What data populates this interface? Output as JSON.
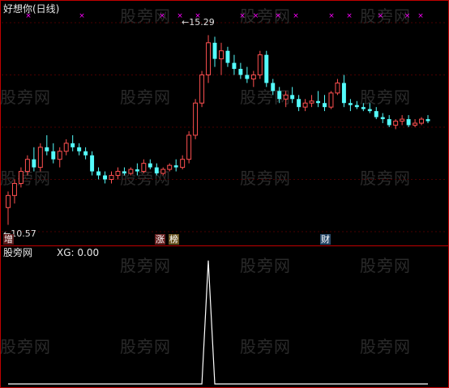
{
  "chart_title": "好想你(日线)",
  "price_high_label": "15.29",
  "price_low_label": "10.57",
  "indicator_name": "股旁网",
  "indicator_value": "XG: 0.00",
  "tags": {
    "zeng": "增",
    "zhang": "涨",
    "bang": "榜",
    "cai": "财"
  },
  "watermark": "股旁网",
  "colors": {
    "up": "#ff5050",
    "down": "#54fcfc",
    "divider": "#c00000",
    "marker": "#ff00ff",
    "signal": "#ffffff"
  },
  "chart_data": [
    {
      "type": "candlestick",
      "candles": [
        [
          11.0,
          11.4,
          10.57,
          11.3
        ],
        [
          11.3,
          11.7,
          11.1,
          11.6
        ],
        [
          11.6,
          12.0,
          11.5,
          11.9
        ],
        [
          11.9,
          12.3,
          11.8,
          12.2
        ],
        [
          12.2,
          12.5,
          11.9,
          12.0
        ],
        [
          12.0,
          12.6,
          11.9,
          12.5
        ],
        [
          12.5,
          12.8,
          12.3,
          12.4
        ],
        [
          12.4,
          12.6,
          12.1,
          12.2
        ],
        [
          12.2,
          12.5,
          12.0,
          12.4
        ],
        [
          12.4,
          12.7,
          12.3,
          12.6
        ],
        [
          12.6,
          12.8,
          12.4,
          12.5
        ],
        [
          12.5,
          12.6,
          12.3,
          12.4
        ],
        [
          12.4,
          12.5,
          12.2,
          12.3
        ],
        [
          12.3,
          12.4,
          11.8,
          11.9
        ],
        [
          11.9,
          12.0,
          11.7,
          11.8
        ],
        [
          11.8,
          11.9,
          11.6,
          11.7
        ],
        [
          11.7,
          11.9,
          11.6,
          11.8
        ],
        [
          11.8,
          12.0,
          11.7,
          11.9
        ],
        [
          11.9,
          12.0,
          11.8,
          11.85
        ],
        [
          11.85,
          12.0,
          11.8,
          11.95
        ],
        [
          11.95,
          12.1,
          11.8,
          11.9
        ],
        [
          11.9,
          12.2,
          11.85,
          12.1
        ],
        [
          12.1,
          12.2,
          11.95,
          12.0
        ],
        [
          12.0,
          12.1,
          11.8,
          11.85
        ],
        [
          11.85,
          12.0,
          11.8,
          11.95
        ],
        [
          11.95,
          12.1,
          11.9,
          12.05
        ],
        [
          12.05,
          12.2,
          11.9,
          12.0
        ],
        [
          12.0,
          12.3,
          11.95,
          12.2
        ],
        [
          12.2,
          12.9,
          12.1,
          12.8
        ],
        [
          12.8,
          13.7,
          12.7,
          13.6
        ],
        [
          13.6,
          14.4,
          13.5,
          14.3
        ],
        [
          14.3,
          15.29,
          14.1,
          15.1
        ],
        [
          15.1,
          15.25,
          14.5,
          14.7
        ],
        [
          14.7,
          15.1,
          14.3,
          14.9
        ],
        [
          14.9,
          15.0,
          14.5,
          14.6
        ],
        [
          14.6,
          14.8,
          14.3,
          14.45
        ],
        [
          14.45,
          14.6,
          14.2,
          14.3
        ],
        [
          14.3,
          14.5,
          14.1,
          14.2
        ],
        [
          14.2,
          14.4,
          14.0,
          14.3
        ],
        [
          14.3,
          14.9,
          14.2,
          14.8
        ],
        [
          14.8,
          14.9,
          14.0,
          14.1
        ],
        [
          14.1,
          14.2,
          13.8,
          13.9
        ],
        [
          13.9,
          14.0,
          13.6,
          13.7
        ],
        [
          13.7,
          13.9,
          13.5,
          13.8
        ],
        [
          13.8,
          14.0,
          13.6,
          13.7
        ],
        [
          13.7,
          13.8,
          13.4,
          13.5
        ],
        [
          13.5,
          13.7,
          13.4,
          13.6
        ],
        [
          13.6,
          13.8,
          13.5,
          13.65
        ],
        [
          13.65,
          13.9,
          13.5,
          13.6
        ],
        [
          13.6,
          13.8,
          13.4,
          13.5
        ],
        [
          13.5,
          13.9,
          13.45,
          13.85
        ],
        [
          13.85,
          14.2,
          13.8,
          14.1
        ],
        [
          14.1,
          14.3,
          13.5,
          13.6
        ],
        [
          13.6,
          13.7,
          13.4,
          13.55
        ],
        [
          13.55,
          13.65,
          13.45,
          13.5
        ],
        [
          13.5,
          13.6,
          13.4,
          13.45
        ],
        [
          13.45,
          13.6,
          13.35,
          13.4
        ],
        [
          13.4,
          13.5,
          13.2,
          13.25
        ],
        [
          13.25,
          13.35,
          13.1,
          13.2
        ],
        [
          13.2,
          13.3,
          13.0,
          13.05
        ],
        [
          13.05,
          13.2,
          12.95,
          13.15
        ],
        [
          13.15,
          13.3,
          13.05,
          13.2
        ],
        [
          13.2,
          13.3,
          13.0,
          13.05
        ],
        [
          13.05,
          13.2,
          13.0,
          13.1
        ],
        [
          13.1,
          13.25,
          13.05,
          13.2
        ],
        [
          13.2,
          13.3,
          13.1,
          13.15
        ]
      ],
      "ylim": [
        10.4,
        15.6
      ],
      "markers_x_ratio": [
        0.06,
        0.18,
        0.36,
        0.4,
        0.44,
        0.54,
        0.57,
        0.62,
        0.66,
        0.74,
        0.78,
        0.85,
        0.91,
        0.94
      ]
    },
    {
      "type": "line",
      "name": "XG",
      "values": [
        0,
        0,
        0,
        0,
        0,
        0,
        0,
        0,
        0,
        0,
        0,
        0,
        0,
        0,
        0,
        0,
        0,
        0,
        0,
        0,
        0,
        0,
        0,
        0,
        0,
        0,
        0,
        0,
        0,
        0,
        0,
        1,
        0,
        0,
        0,
        0,
        0,
        0,
        0,
        0,
        0,
        0,
        0,
        0,
        0,
        0,
        0,
        0,
        0,
        0,
        0,
        0,
        0,
        0,
        0,
        0,
        0,
        0,
        0,
        0,
        0,
        0,
        0,
        0,
        0,
        0
      ],
      "ylim": [
        0,
        1.05
      ]
    }
  ]
}
